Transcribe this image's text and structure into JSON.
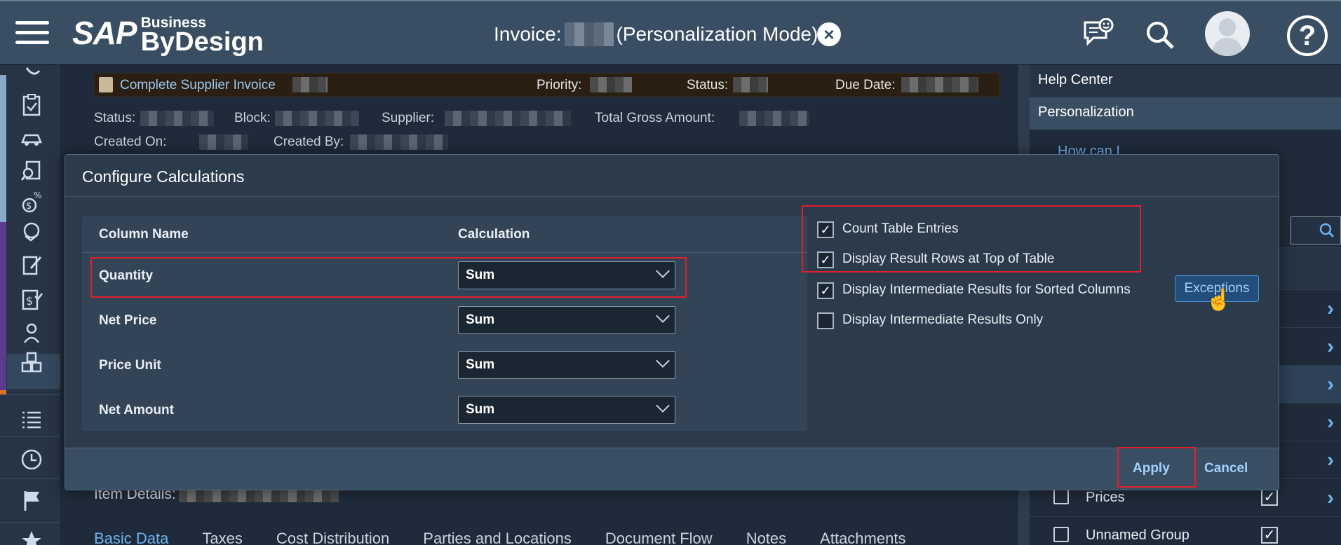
{
  "shell": {
    "logo_sap": "SAP",
    "logo_business": "Business",
    "logo_bydesign": "ByDesign",
    "title_prefix": "Invoice:",
    "title_suffix": "(Personalization Mode)",
    "icons": [
      "menu-icon",
      "feedback-icon",
      "search-icon",
      "user-avatar",
      "help-icon",
      "close-icon"
    ]
  },
  "object": {
    "task": "Complete Supplier Invoice",
    "priority_label": "Priority:",
    "status_label": "Status:",
    "due_label": "Due Date:",
    "fields": {
      "status": "Status:",
      "block": "Block:",
      "supplier": "Supplier:",
      "total": "Total Gross Amount:",
      "created_on": "Created On:",
      "created_by": "Created By:"
    },
    "item_details": "Item Details:",
    "tabs": [
      "Basic Data",
      "Taxes",
      "Cost Distribution",
      "Parties and Locations",
      "Document Flow",
      "Notes",
      "Attachments"
    ]
  },
  "help_pane": {
    "help_center": "Help Center",
    "personalization": "Personalization",
    "how_can": "How can I",
    "list_items": [
      {
        "label": "Prices",
        "checked": true
      },
      {
        "label": "Unnamed Group",
        "checked": true
      }
    ]
  },
  "dialog": {
    "title": "Configure Calculations",
    "col_name": "Column Name",
    "col_calc": "Calculation",
    "rows": [
      {
        "name": "Quantity",
        "calc": "Sum"
      },
      {
        "name": "Net Price",
        "calc": "Sum"
      },
      {
        "name": "Price Unit",
        "calc": "Sum"
      },
      {
        "name": "Net Amount",
        "calc": "Sum"
      }
    ],
    "options": [
      {
        "label": "Count Table Entries",
        "checked": true
      },
      {
        "label": "Display Result Rows at Top of Table",
        "checked": true
      },
      {
        "label": "Display Intermediate Results for Sorted Columns",
        "checked": true
      },
      {
        "label": "Display Intermediate Results Only",
        "checked": false
      }
    ],
    "exceptions": "Exceptions",
    "apply": "Apply",
    "cancel": "Cancel"
  }
}
